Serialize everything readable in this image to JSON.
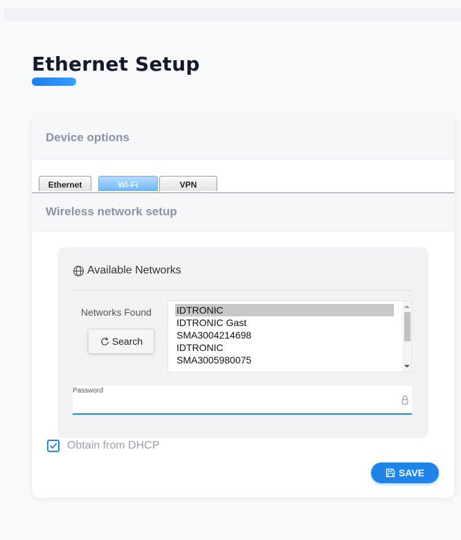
{
  "page": {
    "title": "Ethernet Setup"
  },
  "card": {
    "header_title": "Device options",
    "tabs": [
      {
        "label": "Ethernet",
        "active": false
      },
      {
        "label": "Wi-Fi",
        "active": true
      },
      {
        "label": "VPN",
        "active": false
      }
    ],
    "section_title": "Wireless network setup"
  },
  "networks": {
    "heading": "Available Networks",
    "heading_icon": "globe-icon",
    "found_label": "Networks Found",
    "search_label": "Search",
    "search_icon": "refresh-icon",
    "items": [
      {
        "name": "IDTRONIC",
        "selected": true
      },
      {
        "name": "IDTRONIC Gast",
        "selected": false
      },
      {
        "name": "SMA3004214698",
        "selected": false
      },
      {
        "name": "IDTRONIC",
        "selected": false
      },
      {
        "name": "SMA3005980075",
        "selected": false
      }
    ]
  },
  "password": {
    "label": "Password",
    "value": "",
    "icon": "lock-icon"
  },
  "dhcp": {
    "label": "Obtain from DHCP",
    "checked": true
  },
  "actions": {
    "save_label": "SAVE",
    "save_icon": "floppy-disk-icon"
  },
  "colors": {
    "accent": "#1e84e8",
    "title": "#161a2b",
    "muted_heading": "#8a93a6",
    "tab_active": "#6bb6f7"
  }
}
